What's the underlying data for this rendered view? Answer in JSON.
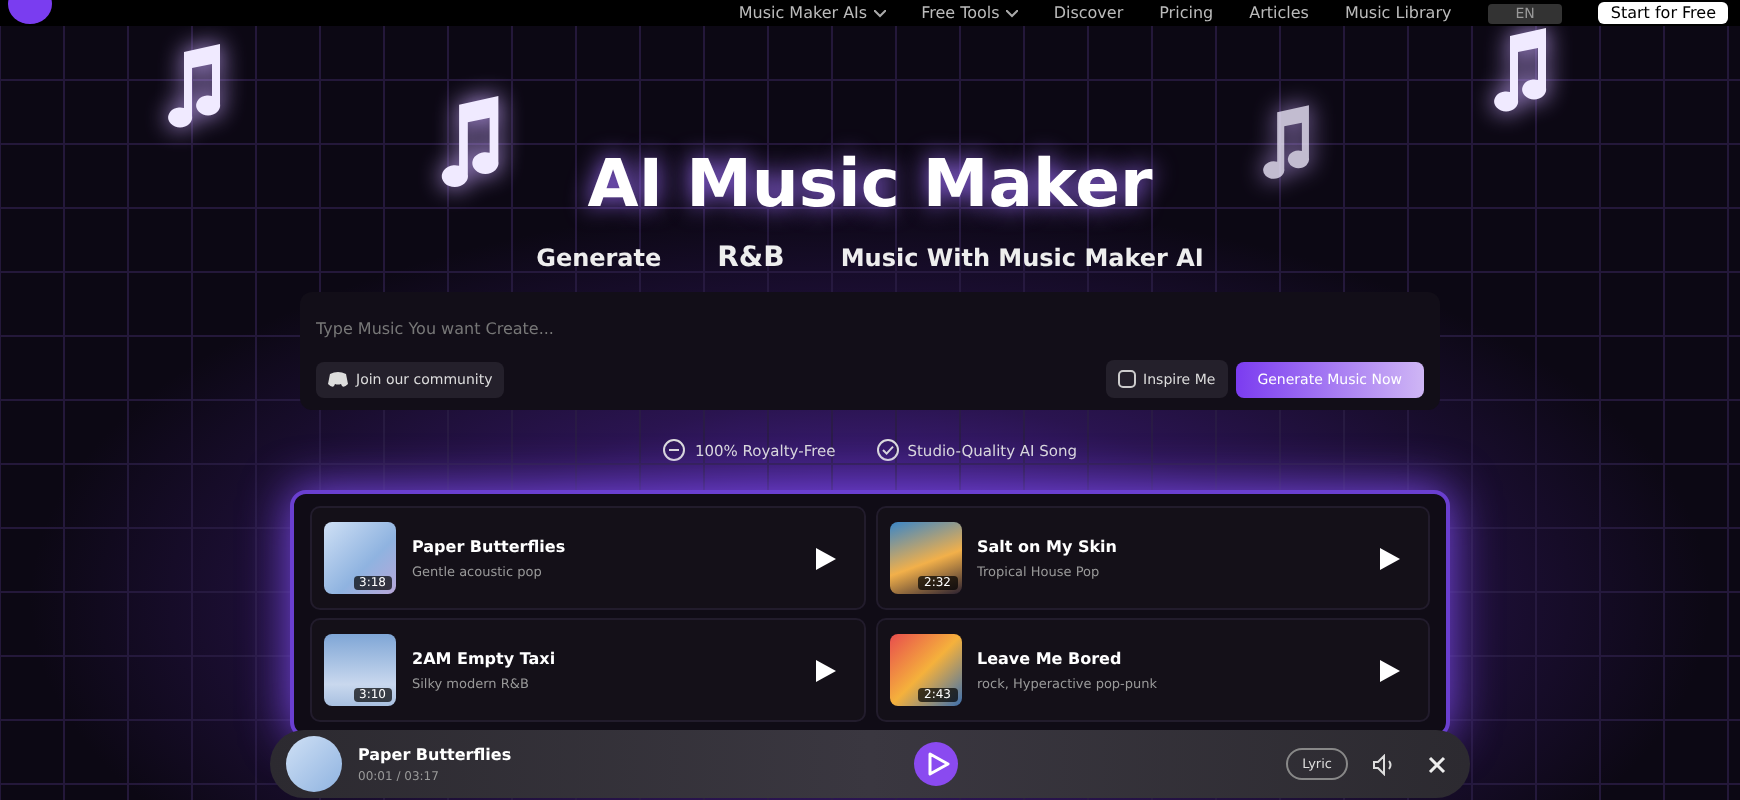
{
  "nav": {
    "items": [
      {
        "label": "Music Maker AIs",
        "dropdown": true
      },
      {
        "label": "Free Tools",
        "dropdown": true
      },
      {
        "label": "Discover",
        "dropdown": false
      },
      {
        "label": "Pricing",
        "dropdown": false
      },
      {
        "label": "Articles",
        "dropdown": false
      },
      {
        "label": "Music Library",
        "dropdown": false
      }
    ],
    "language": "EN",
    "cta": "Start for Free"
  },
  "hero": {
    "title": "AI Music Maker",
    "subtitle_before": "Generate",
    "genre": "R&B",
    "subtitle_after": "Music With Music Maker AI"
  },
  "prompt": {
    "placeholder": "Type Music You want Create...",
    "community": "Join our community",
    "inspire": "Inspire Me",
    "generate": "Generate Music Now"
  },
  "features": [
    "100% Royalty-Free",
    "Studio-Quality AI Song"
  ],
  "songs": [
    {
      "title": "Paper Butterflies",
      "genre": "Gentle acoustic pop",
      "duration": "3:18"
    },
    {
      "title": "Salt on My Skin",
      "genre": "Tropical House Pop",
      "duration": "2:32"
    },
    {
      "title": "2AM Empty Taxi",
      "genre": "Silky modern R&B",
      "duration": "3:10"
    },
    {
      "title": "Leave Me Bored",
      "genre": "rock, Hyperactive pop-punk",
      "duration": "2:43"
    }
  ],
  "player": {
    "title": "Paper Butterflies",
    "time": "00:01 / 03:17",
    "lyric": "Lyric",
    "playing": false
  }
}
